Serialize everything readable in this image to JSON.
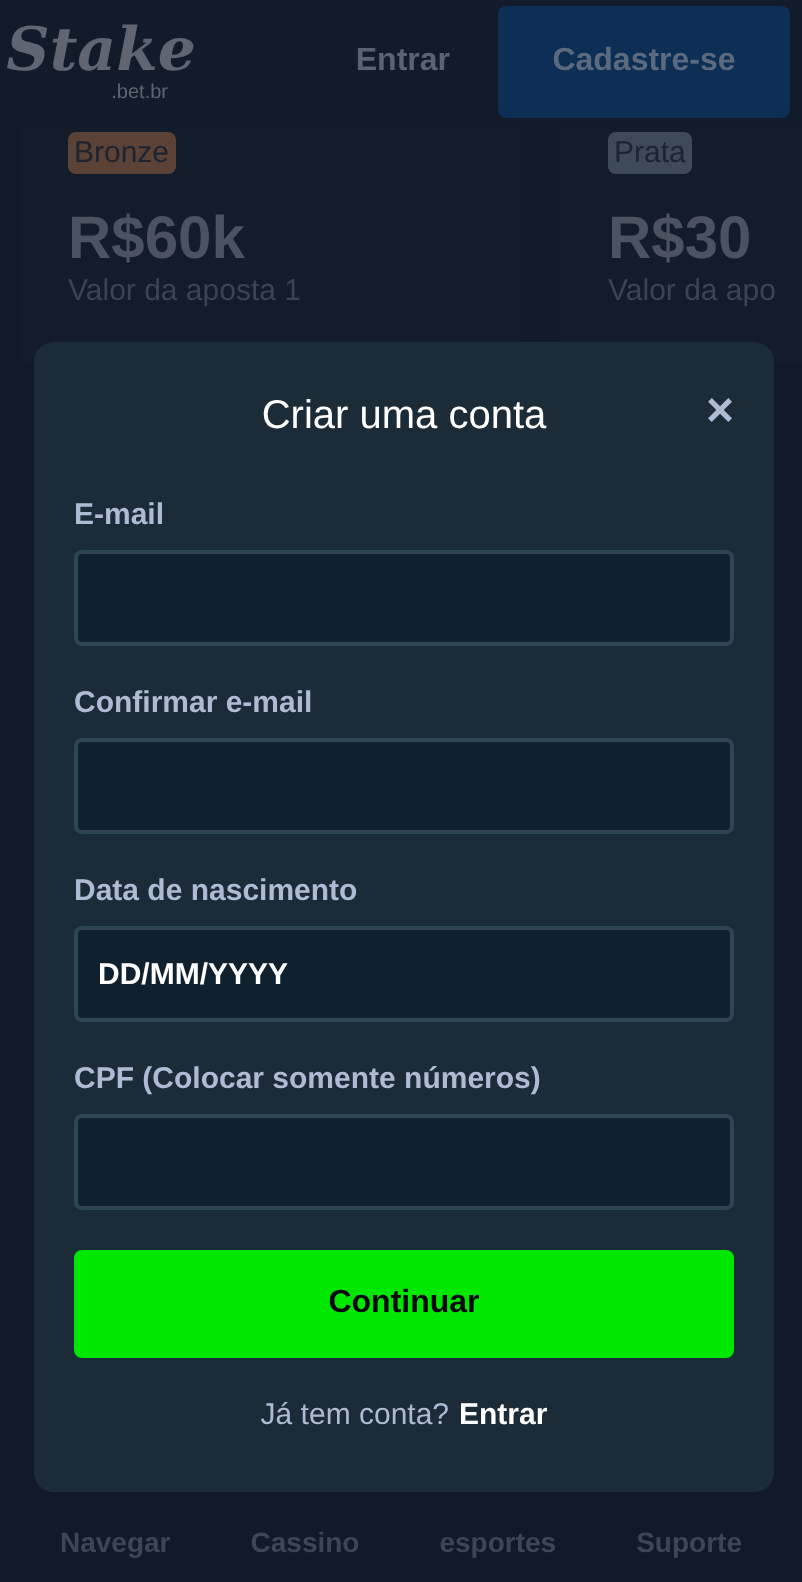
{
  "header": {
    "logo": "Stake",
    "logo_sub": ".bet.br",
    "login": "Entrar",
    "signup": "Cadastre-se"
  },
  "cards": [
    {
      "tier": "Bronze",
      "color": "#5a4336",
      "amount": "R$60k",
      "caption": "Valor da aposta 1"
    },
    {
      "tier": "Prata",
      "color": "#3e4a58",
      "amount": "R$30",
      "caption": "Valor da apo"
    }
  ],
  "modal": {
    "title": "Criar uma conta",
    "close": "×",
    "fields": [
      {
        "label": "E-mail"
      },
      {
        "label": "Confirmar e-mail"
      },
      {
        "label": "Data de nascimento",
        "value": "DD/MM/YYYY"
      },
      {
        "label": "CPF (Colocar somente números)"
      }
    ],
    "submit": "Continuar",
    "footer_text": "Já tem conta?",
    "footer_link": "Entrar"
  },
  "bottom_nav": [
    {
      "label": "Navegar"
    },
    {
      "label": "Cassino"
    },
    {
      "label": "esportes"
    },
    {
      "label": "Suporte"
    }
  ]
}
